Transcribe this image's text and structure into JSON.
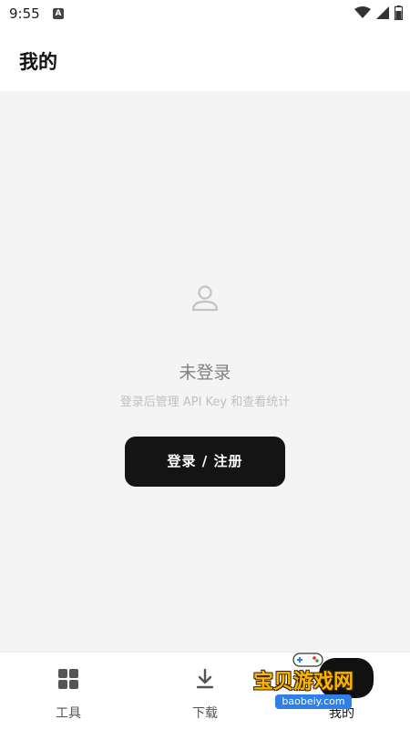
{
  "status_bar": {
    "time": "9:55",
    "notification_icon": "a-letter-icon"
  },
  "header": {
    "title": "我的"
  },
  "empty_state": {
    "icon": "user-icon",
    "status": "未登录",
    "hint": "登录后管理 API Key 和查看统计",
    "login_button": "登录 / 注册"
  },
  "tabbar": {
    "items": [
      {
        "label": "工具",
        "icon": "grid-icon"
      },
      {
        "label": "下载",
        "icon": "download-icon"
      },
      {
        "label": "我的",
        "icon": "profile-icon",
        "active": true
      }
    ]
  },
  "watermark": {
    "text": "宝贝游戏网",
    "url": "baobeiy.com"
  },
  "colors": {
    "content_bg": "#f4f4f4",
    "button_bg": "#141414",
    "watermark_text": "#f7b500"
  }
}
